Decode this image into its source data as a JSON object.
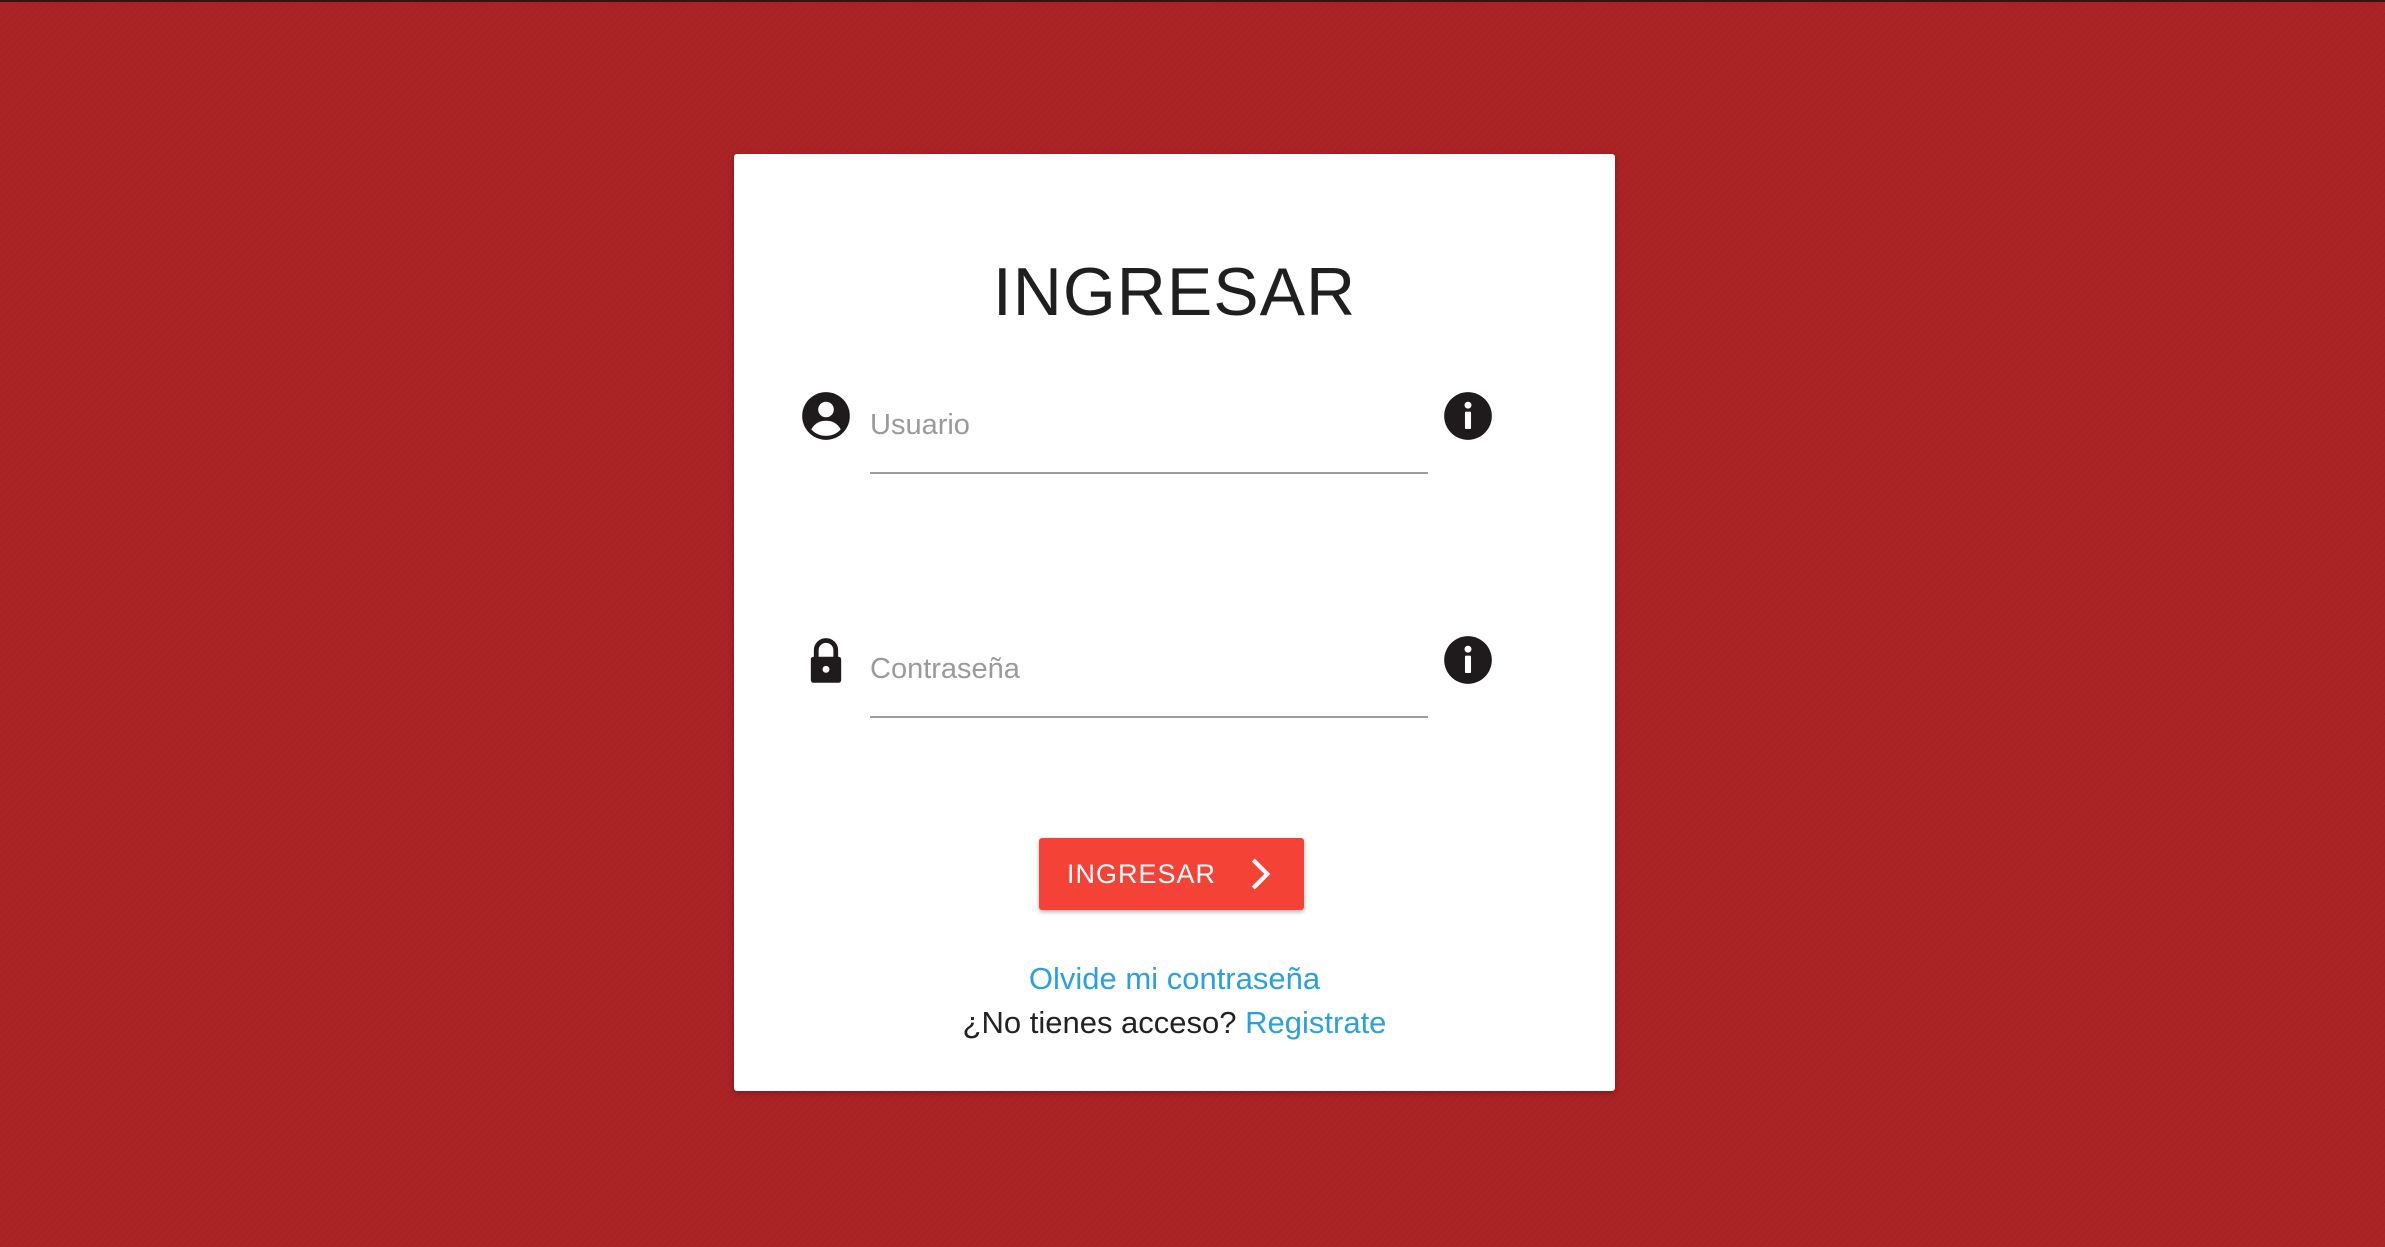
{
  "login": {
    "title": "INGRESAR",
    "username": {
      "placeholder": "Usuario",
      "value": "",
      "leading_icon": "account-circle-icon",
      "trailing_icon": "info-icon"
    },
    "password": {
      "placeholder": "Contraseña",
      "value": "",
      "leading_icon": "lock-icon",
      "trailing_icon": "info-icon"
    },
    "submit_label": "INGRESAR",
    "submit_icon": "chevron-right-icon",
    "forgot_password_label": "Olvide mi contraseña",
    "no_access_text": "¿No tienes acceso?",
    "register_label": "Registrate"
  },
  "colors": {
    "background": "#ac2325",
    "card": "#ffffff",
    "button": "#f44336",
    "link": "#2aa0e0",
    "icon": "#1f1a1c"
  }
}
